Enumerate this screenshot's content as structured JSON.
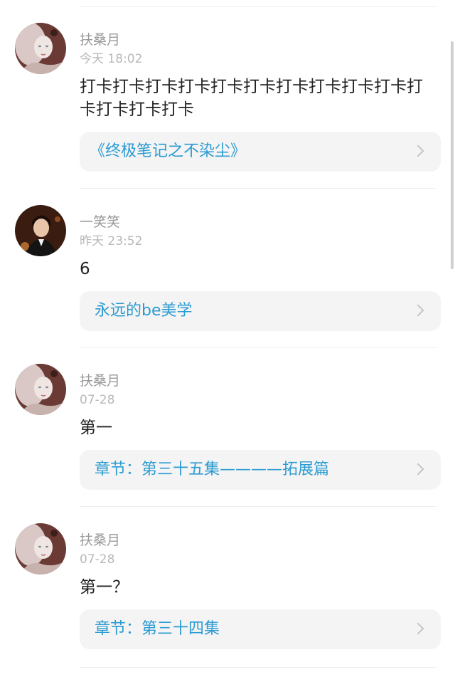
{
  "comments": [
    {
      "user": "扶桑月",
      "time": "今天 18:02",
      "avatar_icon": "girl-portrait-avatar",
      "text": "打卡打卡打卡打卡打卡打卡打卡打卡打卡打卡打卡打卡打卡打卡",
      "link": "《终极笔记之不染尘》"
    },
    {
      "user": "一笑笑",
      "time": "昨天 23:52",
      "avatar_icon": "boy-portrait-avatar",
      "text": "6",
      "link": "永远的be美学"
    },
    {
      "user": "扶桑月",
      "time": "07-28",
      "avatar_icon": "girl-portrait-avatar",
      "text": "第一",
      "link": "章节：第三十五集————拓展篇"
    },
    {
      "user": "扶桑月",
      "time": "07-28",
      "avatar_icon": "girl-portrait-avatar",
      "text": "第一？",
      "link": "章节：第三十四集"
    }
  ],
  "colors": {
    "link": "#2b9bd2",
    "username": "#9a9a9a",
    "timestamp": "#b8b8b8",
    "card_bg": "#f4f4f4"
  }
}
